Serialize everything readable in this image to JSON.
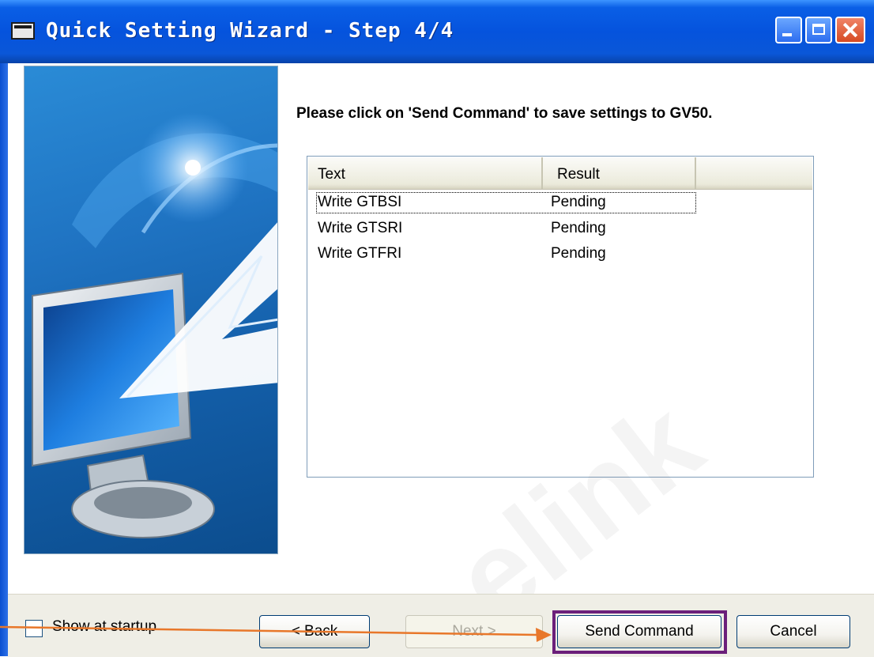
{
  "window": {
    "title": "Quick Setting Wizard - Step 4/4",
    "controls": {
      "minimize": "minimize",
      "maximize": "maximize",
      "close": "close"
    }
  },
  "instruction": "Please click on 'Send Command' to save settings to GV50.",
  "list": {
    "columns": [
      "Text",
      "Result"
    ],
    "rows": [
      {
        "text": "Write GTBSI",
        "result": "Pending"
      },
      {
        "text": "Write GTSRI",
        "result": "Pending"
      },
      {
        "text": "Write GTFRI",
        "result": "Pending"
      }
    ]
  },
  "footer": {
    "show_at_startup_label": "Show at startup",
    "show_at_startup_checked": false,
    "back_label": "< Back",
    "next_label": "Next >",
    "send_label": "Send Command",
    "cancel_label": "Cancel"
  },
  "watermark": "elink",
  "colors": {
    "titlebar": "#0553dd",
    "highlight_box": "#6b1f7a",
    "annotation_arrow": "#e8772a"
  },
  "icons": [
    "window-app-icon",
    "minimize-icon",
    "maximize-icon",
    "close-icon",
    "checkbox-icon",
    "monitor-illustration"
  ]
}
